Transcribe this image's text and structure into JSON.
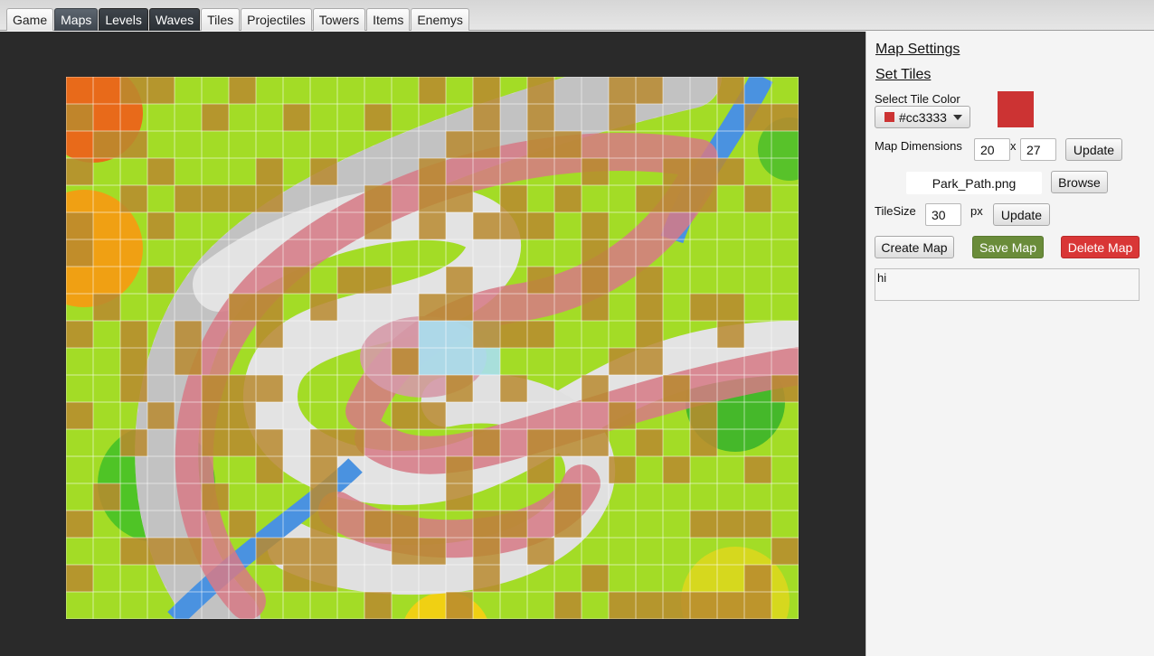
{
  "tabs": [
    "Game",
    "Maps",
    "Levels",
    "Waves",
    "Tiles",
    "Projectiles",
    "Towers",
    "Items",
    "Enemys"
  ],
  "panel": {
    "map_settings": "Map Settings",
    "set_tiles": "Set Tiles",
    "select_tile_color": "Select Tile Color",
    "tile_color_value": "#cc3333",
    "map_dimensions": "Map Dimensions",
    "dim_width": "20",
    "dim_x": "x",
    "dim_height": "27",
    "update": "Update",
    "file_name": "Park_Path.png",
    "browse": "Browse",
    "tilesize_label": "TileSize",
    "tilesize_value": "30",
    "px": "px",
    "create_map": "Create Map",
    "save_map": "Save Map",
    "delete_map": "Delete Map",
    "notes": "hi"
  },
  "map": {
    "columns": 27,
    "rows": 20,
    "highlight_color": "#cc3333",
    "blocked_color": "#b8892f"
  },
  "colors": {
    "grass": "#9ed81f",
    "path": "#e8e8e8",
    "water": "#4a92e0",
    "save_green": "#6a8c3a",
    "delete_red": "#d93636",
    "dark_bg": "#2a2a2a"
  }
}
